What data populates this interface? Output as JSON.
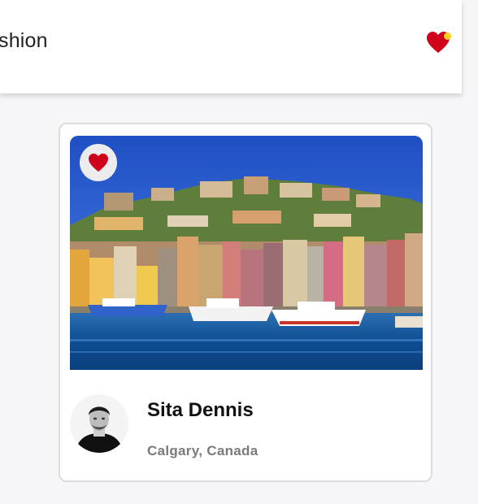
{
  "header": {
    "title": "shion",
    "favorites_icon": "heart-icon",
    "notification_dot_color": "#f5d21d",
    "heart_color": "#d0021b"
  },
  "card": {
    "photo_alt": "Harbor town",
    "favorite_icon": "heart-icon",
    "user": {
      "name": "Sita Dennis",
      "location": "Calgary, Canada"
    }
  }
}
